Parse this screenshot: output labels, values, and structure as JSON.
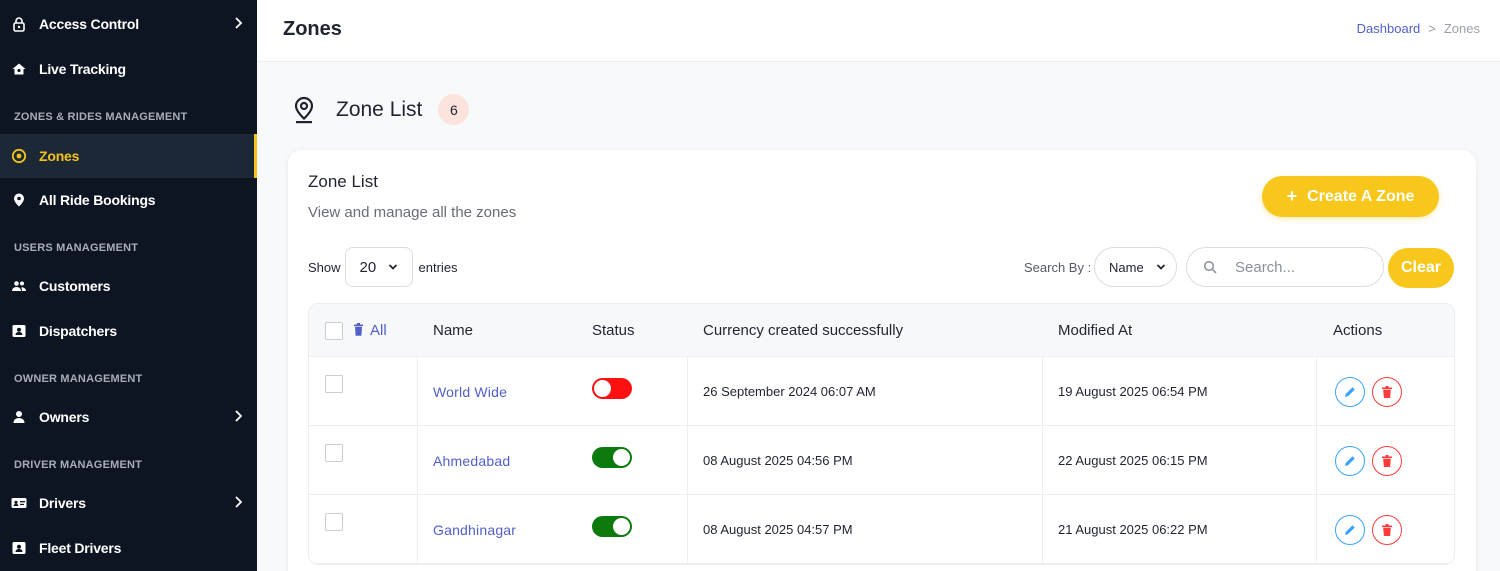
{
  "sidebar": {
    "items": [
      {
        "key": "access",
        "label": "Access Control",
        "icon": "lock-icon",
        "chevron": true
      },
      {
        "key": "tracking",
        "label": "Live Tracking",
        "icon": "home-tracking-icon",
        "chevron": false
      },
      {
        "key": "zones",
        "label": "Zones",
        "icon": "target-circle-icon",
        "chevron": false,
        "active": true
      },
      {
        "key": "bookings",
        "label": "All Ride Bookings",
        "icon": "map-pin-icon",
        "chevron": false
      },
      {
        "key": "customers",
        "label": "Customers",
        "icon": "users-icon",
        "chevron": false
      },
      {
        "key": "dispatchers",
        "label": "Dispatchers",
        "icon": "id-card-icon",
        "chevron": false
      },
      {
        "key": "owners",
        "label": "Owners",
        "icon": "user-icon",
        "chevron": true
      },
      {
        "key": "drivers",
        "label": "Drivers",
        "icon": "driver-card-icon",
        "chevron": true
      },
      {
        "key": "fleet",
        "label": "Fleet Drivers",
        "icon": "id-card-icon",
        "chevron": false
      }
    ],
    "sections": {
      "zones_rides": "ZONES & RIDES MANAGEMENT",
      "users": "USERS MANAGEMENT",
      "owner": "OWNER MANAGEMENT",
      "driver": "DRIVER MANAGEMENT"
    },
    "accent": "#f3c21b",
    "background": "#0d1522"
  },
  "header": {
    "title": "Zones",
    "breadcrumb": {
      "home": "Dashboard",
      "separator": ">",
      "current": "Zones"
    }
  },
  "list_heading": {
    "title": "Zone List",
    "count": "6"
  },
  "card": {
    "title": "Zone List",
    "subtitle": "View and manage all the zones",
    "create_button": {
      "icon": "+",
      "label": "Create A Zone"
    },
    "show_label": "Show",
    "entries_value": "20",
    "entries_label": "entries",
    "search_by_label": "Search By :",
    "search_field_value": "Name",
    "search_placeholder": "Search...",
    "clear_label": "Clear"
  },
  "table": {
    "columns": {
      "select_all": "All",
      "name": "Name",
      "status": "Status",
      "created": "Currency created successfully",
      "modified": "Modified At",
      "actions": "Actions"
    },
    "rows": [
      {
        "name": "World Wide",
        "status": "off",
        "created": "26 September 2024 06:07 AM",
        "modified": "19 August 2025 06:54 PM"
      },
      {
        "name": "Ahmedabad",
        "status": "on",
        "created": "08 August 2025 04:56 PM",
        "modified": "22 August 2025 06:15 PM"
      },
      {
        "name": "Gandhinagar",
        "status": "on",
        "created": "08 August 2025 04:57 PM",
        "modified": "21 August 2025 06:22 PM"
      }
    ]
  },
  "colors": {
    "primary_yellow": "#f7c71c",
    "link_blue": "#5160c9",
    "toggle_on": "#0c7a0c",
    "toggle_off": "#ff1010",
    "edit_blue": "#3aa3ff",
    "delete_red": "#ff3b3b"
  }
}
